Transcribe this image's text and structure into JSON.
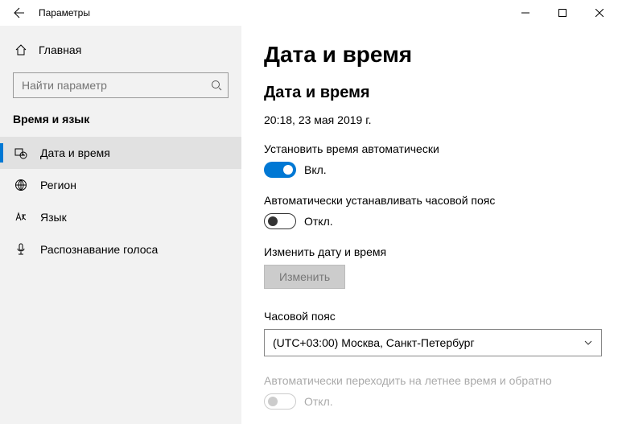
{
  "window": {
    "title": "Параметры"
  },
  "sidebar": {
    "home": "Главная",
    "search_placeholder": "Найти параметр",
    "category": "Время и язык",
    "items": [
      {
        "label": "Дата и время"
      },
      {
        "label": "Регион"
      },
      {
        "label": "Язык"
      },
      {
        "label": "Распознавание голоса"
      }
    ]
  },
  "content": {
    "page_title": "Дата и время",
    "section_title": "Дата и время",
    "current_datetime": "20:18, 23 мая 2019 г.",
    "auto_time": {
      "label": "Установить время автоматически",
      "state": "Вкл."
    },
    "auto_tz": {
      "label": "Автоматически устанавливать часовой пояс",
      "state": "Откл."
    },
    "change_datetime": {
      "label": "Изменить дату и время",
      "button": "Изменить"
    },
    "timezone": {
      "label": "Часовой пояс",
      "value": "(UTC+03:00) Москва, Санкт-Петербург"
    },
    "dst": {
      "label": "Автоматически переходить на летнее время и обратно",
      "state": "Откл."
    }
  }
}
